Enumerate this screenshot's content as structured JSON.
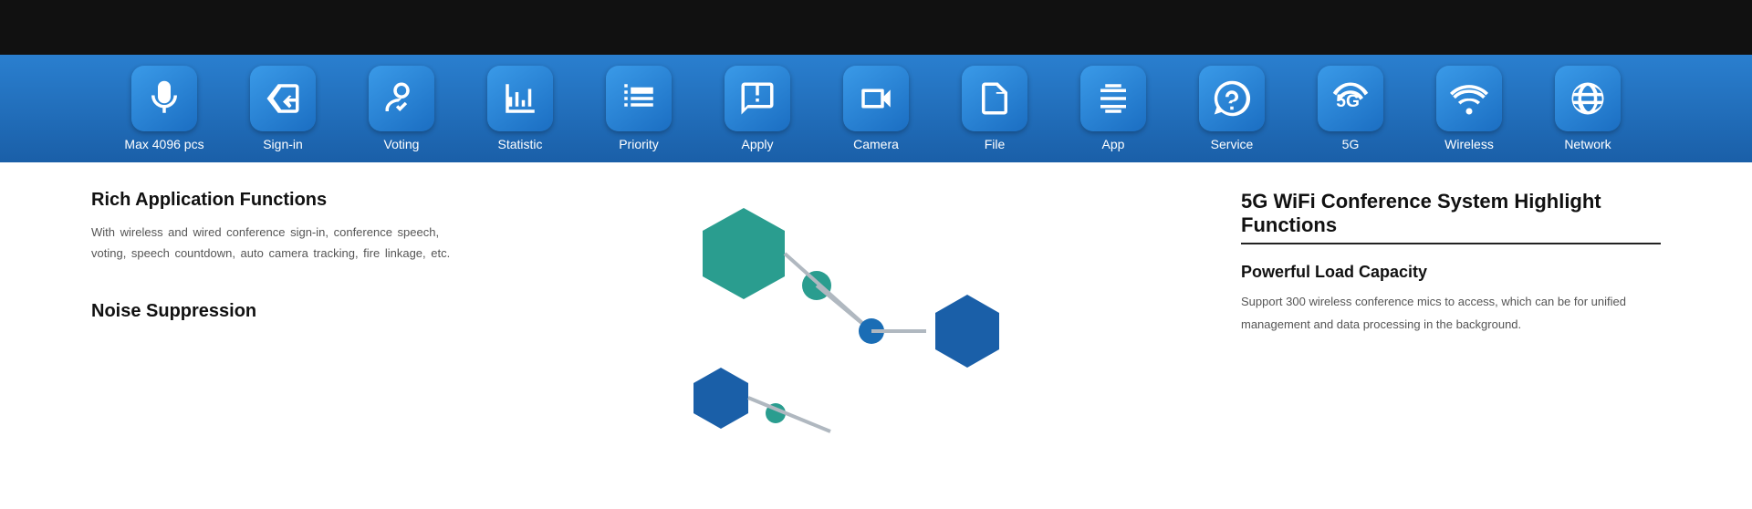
{
  "topBar": {
    "color": "#111111"
  },
  "iconBar": {
    "bgColor": "#1e6ab5",
    "items": [
      {
        "id": "max4096",
        "label": "Max 4096 pcs",
        "icon": "mic"
      },
      {
        "id": "signin",
        "label": "Sign-in",
        "icon": "signin"
      },
      {
        "id": "voting",
        "label": "Voting",
        "icon": "voting"
      },
      {
        "id": "statistic",
        "label": "Statistic",
        "icon": "statistic"
      },
      {
        "id": "priority",
        "label": "Priority",
        "icon": "priority"
      },
      {
        "id": "apply",
        "label": "Apply",
        "icon": "apply"
      },
      {
        "id": "camera",
        "label": "Camera",
        "icon": "camera"
      },
      {
        "id": "file",
        "label": "File",
        "icon": "file"
      },
      {
        "id": "app",
        "label": "App",
        "icon": "app"
      },
      {
        "id": "service",
        "label": "Service",
        "icon": "service"
      },
      {
        "id": "5g",
        "label": "5G",
        "icon": "5g"
      },
      {
        "id": "wireless",
        "label": "Wireless",
        "icon": "wireless"
      },
      {
        "id": "network",
        "label": "Network",
        "icon": "network"
      }
    ]
  },
  "leftSection": {
    "title1": "Rich Application Functions",
    "body1": "With wireless and wired conference sign-in, conference speech, voting, speech countdown, auto camera tracking, fire linkage, etc.",
    "title2": "Noise Suppression"
  },
  "rightSection": {
    "highlightTitle": "5G WiFi Conference System  Highlight Functions",
    "subsectionTitle": "Powerful Load Capacity",
    "subsectionBody": "Support 300 wireless conference mics to access, which can be  for unified management and data processing in the background."
  }
}
